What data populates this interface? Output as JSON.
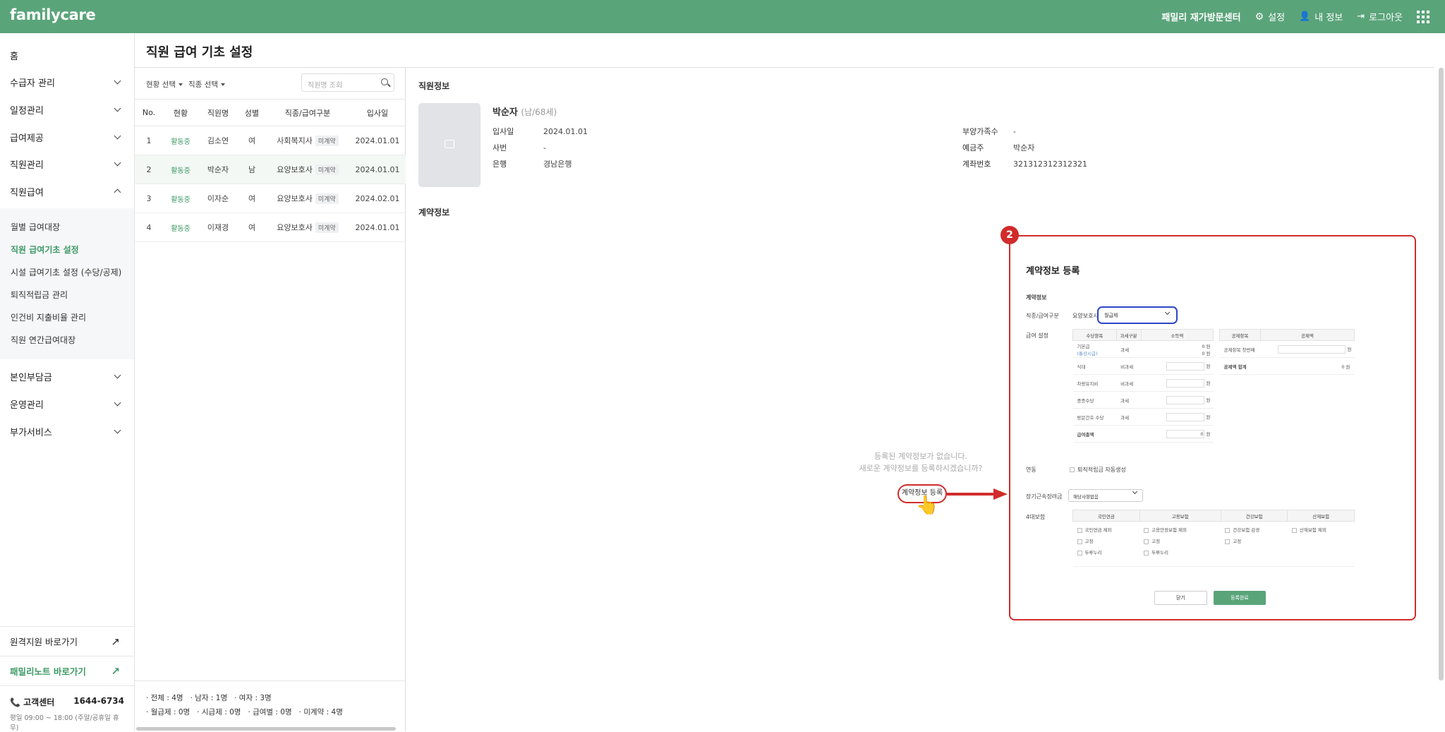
{
  "app": {
    "logo": "familycare"
  },
  "topbar": {
    "center_name": "패밀리 재가방문센터",
    "settings": "설정",
    "my_info": "내 정보",
    "logout": "로그아웃"
  },
  "sidebar": {
    "home": "홈",
    "menus": [
      "수급자 관리",
      "일정관리",
      "급여제공",
      "직원관리",
      "직원급여"
    ],
    "sub_items": [
      "월별 급여대장",
      "직원 급여기초 설정",
      "시설 급여기초 설정 (수당/공제)",
      "퇴직적립금 관리",
      "인건비 지출비율 관리",
      "직원 연간급여대장"
    ],
    "menus2": [
      "본인부담금",
      "운영관리",
      "부가서비스"
    ],
    "links": [
      "원격지원 바로가기",
      "패밀리노트 바로가기"
    ],
    "cs_label": "고객센터",
    "cs_phone": "1644-6734",
    "cs_hours": "평일 09:00 ~ 18:00 (주말/공휴일 휴무)"
  },
  "page": {
    "title": "직원 급여 기초 설정"
  },
  "list": {
    "filter_status": "현황 선택",
    "filter_job": "직종 선택",
    "search_placeholder": "직원명 조회",
    "headers": [
      "No.",
      "현황",
      "직원명",
      "성별",
      "직종/급여구분",
      "입사일"
    ],
    "rows": [
      {
        "no": "1",
        "status": "활동중",
        "name": "김소연",
        "gender": "여",
        "job": "사회복지사",
        "tag": "미계약",
        "date": "2024.01.01"
      },
      {
        "no": "2",
        "status": "활동중",
        "name": "박순자",
        "gender": "남",
        "job": "요양보호사",
        "tag": "미계약",
        "date": "2024.01.01"
      },
      {
        "no": "3",
        "status": "활동중",
        "name": "이자순",
        "gender": "여",
        "job": "요양보호사",
        "tag": "미계약",
        "date": "2024.02.01"
      },
      {
        "no": "4",
        "status": "활동중",
        "name": "이재경",
        "gender": "여",
        "job": "요양보호사",
        "tag": "미계약",
        "date": "2024.01.01"
      }
    ],
    "summary1": [
      "· 전체 : 4명",
      "· 남자 : 1명",
      "· 여자 : 3명"
    ],
    "summary2": [
      "· 월급제 : 0명",
      "· 시급제 : 0명",
      "· 급여별 : 0명",
      "· 미계약 : 4명"
    ]
  },
  "employee": {
    "section": "직원정보",
    "name": "박순자",
    "sub": "(남/68세)",
    "join_label": "입사일",
    "join": "2024.01.01",
    "empno_label": "사번",
    "empno": "-",
    "bank_label": "은행",
    "bank": "경남은행",
    "dependents_label": "부양가족수",
    "dependents": "-",
    "holder_label": "예금주",
    "holder": "박순자",
    "account_label": "계좌번호",
    "account": "321312312312321"
  },
  "contract": {
    "section": "계약정보",
    "empty_line1": "등록된 계약정보가 없습니다.",
    "empty_line2": "새로운 계약정보를 등록하시겠습니까?",
    "register_button": "계약정보 등록"
  },
  "modal": {
    "badge": "2",
    "title": "계약정보 등록",
    "section": "계약정보",
    "job_label": "직종/급여구분",
    "job_value": "요양보호사",
    "pay_type": "월급제",
    "pay_settings_label": "급여 설정",
    "allow_headers": [
      "수당항목",
      "과세구분",
      "소득액"
    ],
    "allowances": [
      {
        "name": "기본급",
        "note": "(통상시급)",
        "tax": "과세",
        "amount": "0 원",
        "amount2": "0 원"
      },
      {
        "name": "식대",
        "tax": "비과세",
        "unit": "원"
      },
      {
        "name": "차량유지비",
        "tax": "비과세",
        "unit": "원"
      },
      {
        "name": "중증수당",
        "tax": "과세",
        "unit": "원"
      },
      {
        "name": "방문간호 수당",
        "tax": "과세",
        "unit": "원"
      }
    ],
    "pay_total_label": "급여총액",
    "pay_total": "0",
    "pay_total_unit": "원",
    "deduct_headers": [
      "공제항목",
      "공제액"
    ],
    "deduct_items": [
      {
        "name": "공제항목 첫번째",
        "unit": "원"
      }
    ],
    "deduct_total_label": "공제액 합계",
    "deduct_total": "0 원",
    "link_label": "연동",
    "link_check": "퇴직적립금 자동생성",
    "longterm_label": "장기근속장려금",
    "longterm_value": "해당사항없음",
    "ins_label": "4대보험",
    "ins_headers": [
      "국민연금",
      "고용보험",
      "건강보험",
      "산재보험"
    ],
    "ins_col1": [
      "국민연금 제외",
      "고정",
      "두루누리"
    ],
    "ins_col2": [
      "고용안정보험 제외",
      "고정",
      "두루누리"
    ],
    "ins_col3": [
      "건강보험 감경",
      "고정"
    ],
    "ins_col4": [
      "산재보험 제외"
    ],
    "close_button": "닫기",
    "submit_button": "등록완료"
  }
}
